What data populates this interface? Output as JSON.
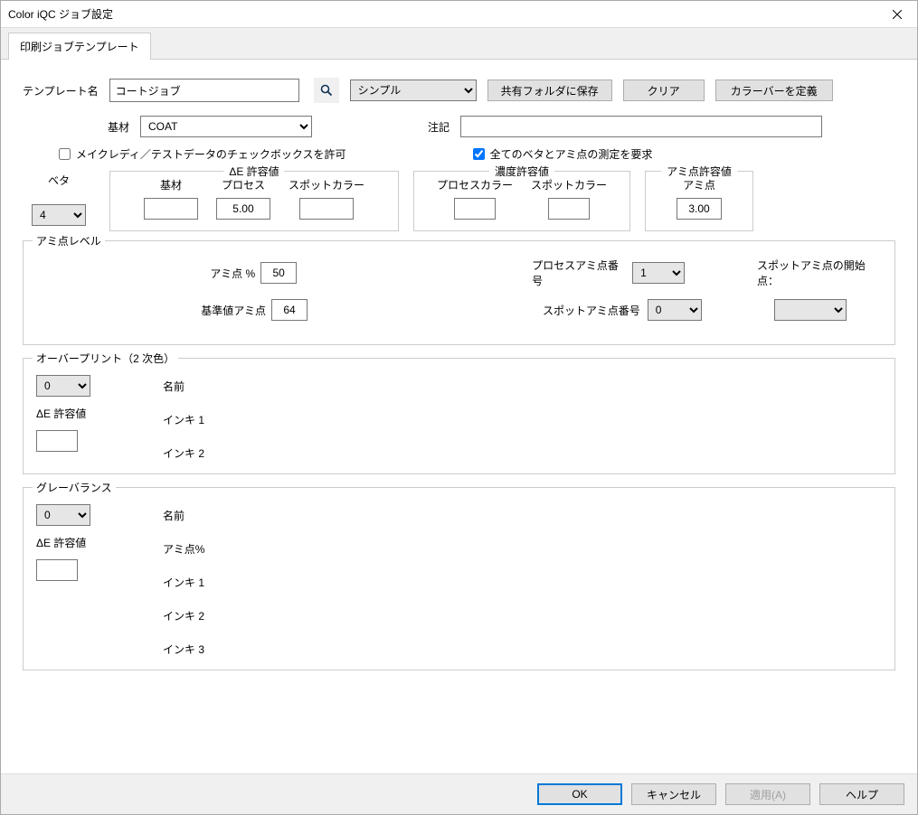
{
  "window": {
    "title": "Color iQC ジョブ設定"
  },
  "tab": {
    "print_template": "印刷ジョブテンプレート"
  },
  "labels": {
    "template_name": "テンプレート名",
    "substrate": "基材",
    "note": "注記",
    "allow_makeready": "メイクレディ／テストデータのチェックボックスを許可",
    "require_all": "全てのベタとアミ点の測定を要求",
    "beta": "ベタ",
    "de_tolerance": "ΔE 許容値",
    "density_tolerance": "濃度許容値",
    "tint_tolerance": "アミ点許容値",
    "substrate_col": "基材",
    "process": "プロセス",
    "spot_color": "スポットカラー",
    "process_color": "プロセスカラー",
    "tint": "アミ点",
    "tint_level": "アミ点レベル",
    "tint_percent": "アミ点 %",
    "ref_tint": "基準値アミ点",
    "process_tint_no": "プロセスアミ点番号",
    "spot_tint_no": "スポットアミ点番号",
    "spot_tint_start": "スポットアミ点の開始点：",
    "overprint": "オーバープリント（2 次色）",
    "name": "名前",
    "ink1": "インキ 1",
    "ink2": "インキ 2",
    "ink3": "インキ 3",
    "gray_balance": "グレーバランス",
    "tint_pct2": "アミ点%"
  },
  "values": {
    "template_name": "コートジョブ",
    "substrate_sel": "COAT",
    "view_mode": "シンプル",
    "note": "",
    "allow_makeready": false,
    "require_all": true,
    "beta": "4",
    "de_substrate": "",
    "de_process": "5.00",
    "de_spot": "",
    "dens_process": "",
    "dens_spot": "",
    "tint_val": "3.00",
    "tint_percent": "50",
    "ref_tint": "64",
    "process_tint_no": "1",
    "spot_tint_no": "0",
    "spot_tint_start": "",
    "overprint_sel": "0",
    "overprint_de": "",
    "gray_sel": "0",
    "gray_de": ""
  },
  "buttons": {
    "save_shared": "共有フォルダに保存",
    "clear": "クリア",
    "define_colorbar": "カラーバーを定義",
    "ok": "OK",
    "cancel": "キャンセル",
    "apply": "適用(A)",
    "help": "ヘルプ"
  }
}
